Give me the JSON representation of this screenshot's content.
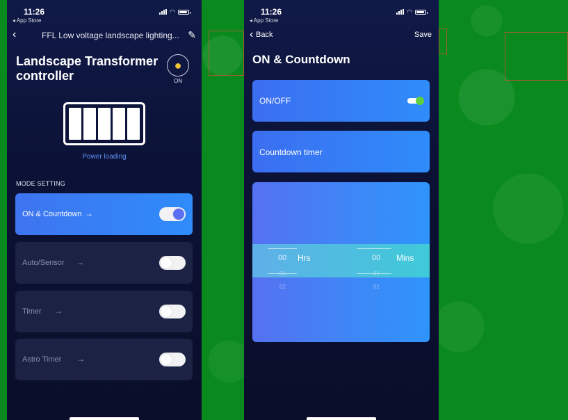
{
  "left": {
    "status": {
      "time": "11:26",
      "back_app": "◂ App Store"
    },
    "nav": {
      "title": "FFL Low voltage landscape lighting..."
    },
    "title": "Landscape Transformer controller",
    "bulb_state": "ON",
    "power_label": "Power loading",
    "section_label": "MODE SETTING",
    "modes": [
      {
        "label": "ON & Countdown",
        "arrow": "→",
        "enabled": true
      },
      {
        "label": "Auto/Sensor",
        "arrow": "→",
        "enabled": false
      },
      {
        "label": "Timer",
        "arrow": "→",
        "enabled": false
      },
      {
        "label": "Astro Timer",
        "arrow": "→",
        "enabled": false
      }
    ]
  },
  "right": {
    "status": {
      "time": "11:26",
      "back_app": "◂ App Store"
    },
    "nav": {
      "back_label": "Back",
      "save_label": "Save"
    },
    "title": "ON & Countdown",
    "onoff": {
      "label": "ON/OFF",
      "enabled": true
    },
    "countdown_label": "Countdown timer",
    "picker": {
      "hours": {
        "selected": "00",
        "next": [
          "01",
          "02"
        ],
        "unit": "Hrs"
      },
      "mins": {
        "selected": "00",
        "next": [
          "01",
          "02"
        ],
        "unit": "Mins"
      }
    }
  },
  "colors": {
    "background": "#0a8a1e",
    "accent_blue": "#2f8cfa",
    "toggle_knob_on": "#5a6ff4",
    "mini_toggle_knob": "#5fcf3f",
    "power_label": "#5f8df2"
  },
  "icons": [
    "chevron-left-icon",
    "edit-icon",
    "bulb-icon",
    "battery-level-icon",
    "signal-icon",
    "wifi-icon",
    "battery-icon"
  ]
}
